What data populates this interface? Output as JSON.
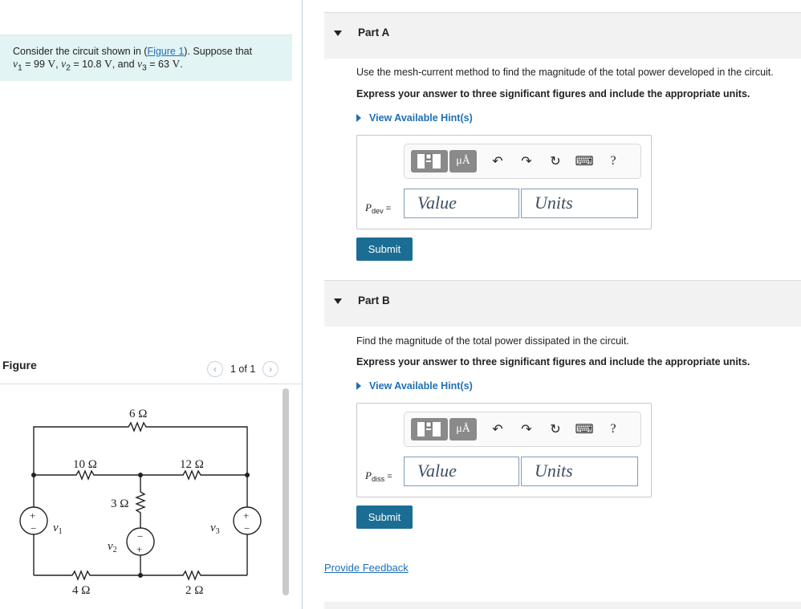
{
  "problem": {
    "text_before_link": "Consider the circuit shown in (",
    "link": "Figure 1",
    "text_after_link": "). Suppose that",
    "line2": [
      {
        "sym": "v",
        "sub": "1",
        "rest": " = 99 ",
        "unit": "V",
        "sep": ", "
      },
      {
        "sym": "v",
        "sub": "2",
        "rest": " = 10.8 ",
        "unit": "V",
        "sep": ", and "
      },
      {
        "sym": "v",
        "sub": "3",
        "rest": " = 63 ",
        "unit": "V",
        "sep": "."
      }
    ]
  },
  "figure": {
    "title": "Figure",
    "prev_icon": "‹",
    "next_icon": "›",
    "count": "1 of 1",
    "circuit": {
      "labels": {
        "r6": "6 Ω",
        "r10": "10 Ω",
        "r12": "12 Ω",
        "r3": "3 Ω",
        "r4": "4 Ω",
        "r2": "2 Ω",
        "v1": "v",
        "v1sub": "1",
        "v2": "v",
        "v2sub": "2",
        "v3": "v",
        "v3sub": "3",
        "plus": "+",
        "minus": "−"
      }
    }
  },
  "toolbar": {
    "units_glyph": "μÅ",
    "undo_icon": "↶",
    "redo_icon": "↷",
    "reset_icon": "↻",
    "keyboard_icon": "⌨",
    "help_icon": "?"
  },
  "partA": {
    "label": "Part A",
    "question": "Use the mesh-current method to find the magnitude of the total power developed in the circuit.",
    "instruction": "Express your answer to three significant figures and include the appropriate units.",
    "hint": "View Available Hint(s)",
    "var": "P",
    "var_sub": "dev",
    "eq": " =",
    "value_placeholder": "Value",
    "units_placeholder": "Units",
    "submit": "Submit"
  },
  "partB": {
    "label": "Part B",
    "question": "Find the magnitude of the total power dissipated in the circuit.",
    "instruction": "Express your answer to three significant figures and include the appropriate units.",
    "hint": "View Available Hint(s)",
    "var": "P",
    "var_sub": "diss",
    "eq": " =",
    "value_placeholder": "Value",
    "units_placeholder": "Units",
    "submit": "Submit"
  },
  "feedback": "Provide Feedback"
}
